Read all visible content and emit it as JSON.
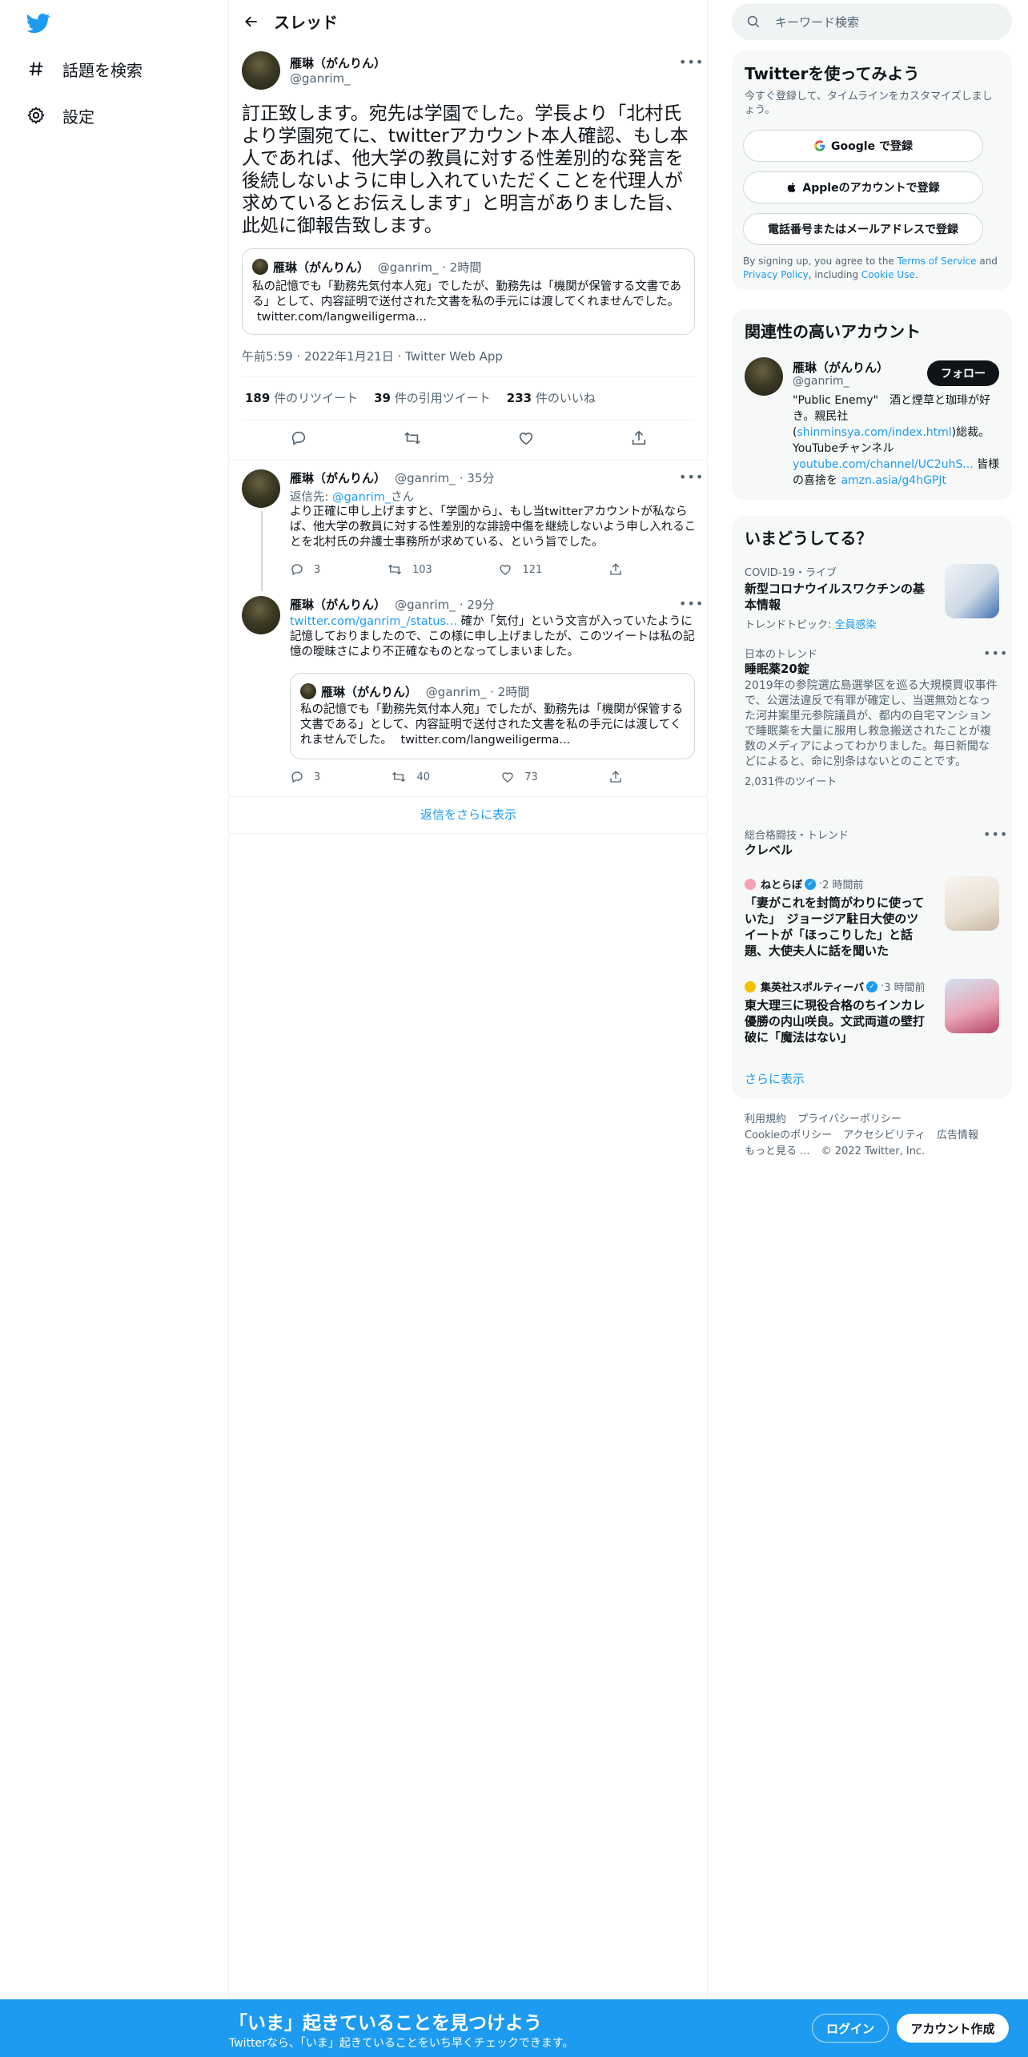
{
  "nav": {
    "items": [
      {
        "label": "話題を検索",
        "icon": "hashtag-icon"
      },
      {
        "label": "設定",
        "icon": "gear-icon"
      }
    ]
  },
  "header": {
    "title": "スレッド"
  },
  "main_tweet": {
    "name": "雁琳（がんりん）",
    "handle": "@ganrim_",
    "text": "訂正致します。宛先は学園でした。学長より「北村氏より学園宛てに、twitterアカウント本人確認、もし本人であれば、他大学の教員に対する性差別的な発言を後続しないように申し入れていただくことを代理人が求めているとお伝えします」と明言がありました旨、此処に御報告致します。",
    "quote": {
      "name": "雁琳（がんりん）",
      "handle": "@ganrim_",
      "time": "2時間",
      "text": "私の記憶でも「勤務先気付本人宛」でしたが、勤務先は「機関が保管する文書である」として、内容証明で送付された文書を私の手元には渡してくれませんでした。",
      "link": "twitter.com/langweiligerma..."
    },
    "timestamp": "午前5:59 · 2022年1月21日 · Twitter Web App",
    "retweets": "189",
    "retweets_label": "件のリツイート",
    "quotes": "39",
    "quotes_label": "件の引用ツイート",
    "likes": "233",
    "likes_label": "件のいいね"
  },
  "replies": [
    {
      "name": "雁琳（がんりん）",
      "handle": "@ganrim_",
      "time": "35分",
      "reply_to_prefix": "返信先: ",
      "reply_to_handle": "@ganrim_",
      "reply_to_suffix": "さん",
      "text": "より正確に申し上げますと、「学園から」、もし当twitterアカウントが私ならば、他大学の教員に対する性差別的な誹謗中傷を継続しないよう申し入れることを北村氏の弁護士事務所が求めている、という旨でした。",
      "reply_count": "3",
      "retweet_count": "103",
      "like_count": "121"
    },
    {
      "name": "雁琳（がんりん）",
      "handle": "@ganrim_",
      "time": "29分",
      "link": "twitter.com/ganrim_/status...",
      "text": "確か「気付」という文言が入っていたように記憶しておりましたので、この様に申し上げましたが、このツイートは私の記憶の曖昧さにより不正確なものとなってしまいました。",
      "quote": {
        "name": "雁琳（がんりん）",
        "handle": "@ganrim_",
        "time": "2時間",
        "text": "私の記憶でも「勤務先気付本人宛」でしたが、勤務先は「機関が保管する文書である」として、内容証明で送付された文書を私の手元には渡してくれませんでした。",
        "link": "twitter.com/langweiligerma..."
      },
      "reply_count": "3",
      "retweet_count": "40",
      "like_count": "73"
    }
  ],
  "show_more_replies": "返信をさらに表示",
  "search": {
    "placeholder": "キーワード検索"
  },
  "signup": {
    "title": "Twitterを使ってみよう",
    "subtitle": "今すぐ登録して、タイムラインをカスタマイズしましょう。",
    "google": "Google で登録",
    "apple": "Appleのアカウントで登録",
    "phone": "電話番号またはメールアドレスで登録",
    "terms_prefix": "By signing up, you agree to the ",
    "terms_link": "Terms of Service",
    "terms_and": " and ",
    "privacy_link": "Privacy Policy",
    "terms_including": ", including ",
    "cookie_link": "Cookie Use",
    "terms_end": "."
  },
  "related": {
    "title": "関連性の高いアカウント",
    "name": "雁琳（がんりん）",
    "handle": "@ganrim_",
    "follow": "フォロー",
    "bio_1": "\"Public Enemy\"　酒と煙草と珈琲が好き。親民社(",
    "bio_link_1": "shinminsya.com/index.html",
    "bio_2": ")総裁。YouTubeチャンネル",
    "bio_link_2": "youtube.com/channel/UC2uhS...",
    "bio_3": " 皆様の喜捨を ",
    "bio_link_3": "amzn.asia/g4hGPJt"
  },
  "trends": {
    "title": "いまどうしてる？",
    "items": [
      {
        "meta": "COVID-19・ライブ",
        "name": "新型コロナウイルスワクチンの基本情報",
        "topic_prefix": "トレンドトピック: ",
        "topic": "全員感染"
      },
      {
        "meta": "日本のトレンド",
        "name": "睡眠薬20錠",
        "desc": "2019年の参院選広島選挙区を巡る大規模買収事件で、公選法違反で有罪が確定し、当選無効となった河井案里元参院議員が、都内の自宅マンションで睡眠薬を大量に服用し救急搬送されたことが複数のメディアによってわかりました。毎日新聞などによると、命に別条はないとのことです。",
        "count": "2,031件のツイート"
      },
      {
        "meta": "総合格闘技・トレンド",
        "name": "クレベル"
      },
      {
        "source": "ねとらぼ",
        "time": "2 時間前",
        "name": "「妻がこれを封筒がわりに使っていた」　ジョージア駐日大使のツイートが「ほっこりした」と話題、大使夫人に話を聞いた"
      },
      {
        "source": "集英社スポルティーバ",
        "time": "3 時間前",
        "name": "東大理三に現役合格のちインカレ優勝の内山咲良。文武両道の壁打破に「魔法はない」"
      }
    ],
    "show_more": "さらに表示"
  },
  "footer": {
    "links": [
      "利用規約",
      "プライバシーポリシー",
      "Cookieのポリシー",
      "アクセシビリティ",
      "広告情報",
      "もっと見る ..."
    ],
    "copyright": "© 2022 Twitter, Inc."
  },
  "bottom": {
    "title": "「いま」起きていることを見つけよう",
    "subtitle": "Twitterなら、「いま」起きていることをいち早くチェックできます。",
    "login": "ログイン",
    "signup": "アカウント作成"
  },
  "colors": {
    "accent": "#1d9bf0",
    "text": "#0f1419",
    "muted": "#536471"
  }
}
